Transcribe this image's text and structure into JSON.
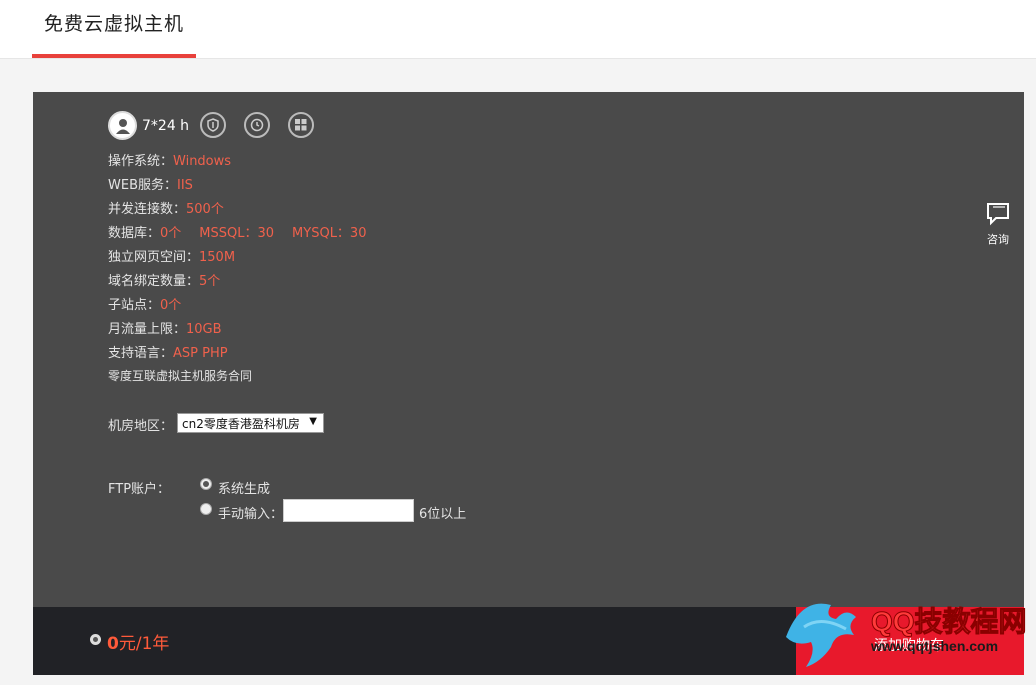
{
  "header": {
    "title": "免费云虚拟主机"
  },
  "features": {
    "hours": "7*24 h",
    "icons": [
      "user-icon",
      "shield-icon",
      "clock-icon",
      "windows-icon"
    ]
  },
  "specs": {
    "os": {
      "label": "操作系统：",
      "value": "Windows"
    },
    "web": {
      "label": "WEB服务：",
      "value": "IIS"
    },
    "concurrency": {
      "label": "并发连接数：",
      "value": "500个"
    },
    "db": {
      "label": "数据库：",
      "value": "0个",
      "mssql": "MSSQL：30",
      "mysql": "MYSQL：30"
    },
    "space": {
      "label": "独立网页空间：",
      "value": "150M"
    },
    "domains": {
      "label": "域名绑定数量：",
      "value": "5个"
    },
    "subsites": {
      "label": "子站点：",
      "value": "0个"
    },
    "traffic": {
      "label": "月流量上限：",
      "value": "10GB"
    },
    "languages": {
      "label": "支持语言：",
      "value": "ASP PHP"
    },
    "contract": "零度互联虚拟主机服务合同"
  },
  "region": {
    "label": "机房地区：",
    "selected": "cn2零度香港盈科机房"
  },
  "ftp": {
    "label": "FTP账户：",
    "option_auto": "系统生成",
    "option_manual": "手动输入：",
    "manual_value": "",
    "hint": "6位以上"
  },
  "consult": {
    "label": "咨询"
  },
  "footer": {
    "price_amount": "0",
    "price_unit": "元/1年",
    "cart_label": "添加购物车"
  },
  "watermark": {
    "text_top": "QQ技教程网",
    "text_bottom": "www.qqtjshen.com"
  },
  "colors": {
    "accent": "#e8413b",
    "value": "#f0614c",
    "panel": "#4a4a4a",
    "footer": "#212226",
    "cart": "#e8192c"
  }
}
